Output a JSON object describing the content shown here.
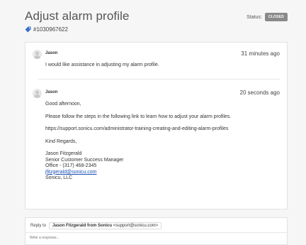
{
  "header": {
    "title": "Adjust alarm profile",
    "ticket_id": "#1030967622",
    "status_label": "Status:",
    "status_value": "CLOSED"
  },
  "messages": [
    {
      "sender": "Jason",
      "time": "31 minutes ago",
      "lines": [
        "I would like assistance in adjusting my alarm profile."
      ]
    },
    {
      "sender": "Jason",
      "time": "20 seconds ago",
      "greeting": "Good afternoon,",
      "instruction": "Please follow the steps in the following link to learn how to adjust your alarm profiles.",
      "link": "https://support.sonicu.com/administrator-training-creating-and-editing-alarm-profiles",
      "closing": "Kind Regards,",
      "signature": {
        "name": "Jason Fitzgerald",
        "role": "Senior Customer Success Manager",
        "office": "Office - (317) 468-2345",
        "email": "jfitzgerald@sonicu.com",
        "company": "Sonicu, LLC"
      }
    }
  ],
  "reply": {
    "label": "Reply to",
    "to_name": "Jason Fitzgerald from Sonicu",
    "to_email": "<support@sonicu.com>",
    "placeholder": "Write a response..."
  },
  "icons": {
    "tag": "tag-icon",
    "avatar": "user-avatar-icon"
  },
  "colors": {
    "status_badge": "#8a8a8a",
    "link": "#1a4fb3"
  }
}
